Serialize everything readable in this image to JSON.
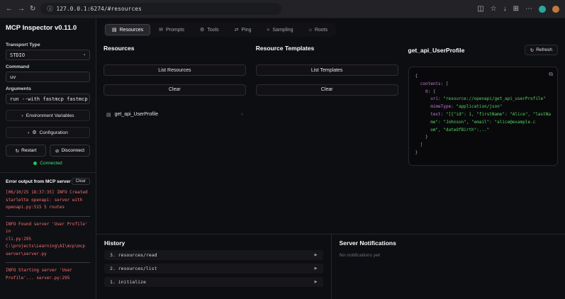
{
  "colors": {
    "accent_green": "#22c55e",
    "error_red": "#f87171",
    "code_string_green": "#56d364",
    "code_key_purple": "#c678dd",
    "panel_background": "#0c0e12"
  },
  "browser": {
    "back_icon": "←",
    "forward_icon": "→",
    "refresh_icon": "↻",
    "site_info_icon": "ⓘ",
    "url": "127.0.0.1:6274/#resources",
    "right_icons": [
      "◫",
      "☆",
      "↓",
      "⊞",
      "⋯"
    ]
  },
  "sidebar": {
    "title": "MCP Inspector v0.11.0",
    "transport": {
      "label": "Transport Type",
      "value": "STDIO"
    },
    "command": {
      "label": "Command",
      "value": "uv"
    },
    "arguments": {
      "label": "Arguments",
      "value": "run --with fastmcp fastmcp run som"
    },
    "env_button": "Environment Variables",
    "config_button": "Configuration",
    "restart_button": "Restart",
    "disconnect_button": "Disconnect",
    "status": "Connected",
    "error_panel": {
      "title": "Error output from MCP server",
      "clear_button": "Clear",
      "log_blocks": [
        [
          "[06/10/25 18:37:35] INFO Created",
          "starlette openapi: server with",
          "openapi.py:515 5 routes"
        ],
        [
          "INFO Found server 'User Profile' in",
          "cli.py:295",
          "C:\\projects\\Learning\\AI\\mcp\\mcp",
          "server\\server.py"
        ],
        [
          "INFO Starting server 'User",
          "Profile'... server.py:295"
        ]
      ]
    }
  },
  "tabs": [
    {
      "icon": "▤",
      "label": "Resources",
      "active": true
    },
    {
      "icon": "✉",
      "label": "Prompts",
      "active": false
    },
    {
      "icon": "⚙",
      "label": "Tools",
      "active": false
    },
    {
      "icon": "⇄",
      "label": "Ping",
      "active": false
    },
    {
      "icon": "≈",
      "label": "Sampling",
      "active": false
    },
    {
      "icon": "⌂",
      "label": "Roots",
      "active": false
    }
  ],
  "resources": {
    "title": "Resources",
    "list_button": "List Resources",
    "clear_button": "Clear",
    "items": [
      {
        "name": "get_api_UserProfile"
      }
    ]
  },
  "templates": {
    "title": "Resource Templates",
    "list_button": "List Templates",
    "clear_button": "Clear"
  },
  "detail": {
    "title": "get_api_UserProfile",
    "refresh_icon": "↻",
    "refresh_button": "Refresh",
    "copy_icon": "⧉",
    "code_lines": [
      [
        {
          "c": "pun",
          "t": "{"
        }
      ],
      [
        {
          "c": "pun",
          "t": "  "
        },
        {
          "c": "key",
          "t": "contents"
        },
        {
          "c": "pun",
          "t": ": ["
        }
      ],
      [
        {
          "c": "pun",
          "t": "    "
        },
        {
          "c": "key",
          "t": "0"
        },
        {
          "c": "pun",
          "t": ": {"
        }
      ],
      [
        {
          "c": "pun",
          "t": "      "
        },
        {
          "c": "key",
          "t": "uri"
        },
        {
          "c": "pun",
          "t": ": "
        },
        {
          "c": "str",
          "t": "\"resource://openapi/get_api_userProfile\""
        }
      ],
      [
        {
          "c": "pun",
          "t": "      "
        },
        {
          "c": "key",
          "t": "mimeType"
        },
        {
          "c": "pun",
          "t": ": "
        },
        {
          "c": "str",
          "t": "\"application/json\""
        }
      ],
      [
        {
          "c": "pun",
          "t": "      "
        },
        {
          "c": "key",
          "t": "text"
        },
        {
          "c": "pun",
          "t": ": "
        },
        {
          "c": "str",
          "t": "\"[{\"id\": 1, \"firstName\": \"Alice\", \"lastNa"
        }
      ],
      [
        {
          "c": "pun",
          "t": "      "
        },
        {
          "c": "str",
          "t": "me\": \"Johnson\", \"email\": \"alice@example.c"
        }
      ],
      [
        {
          "c": "pun",
          "t": "      "
        },
        {
          "c": "str",
          "t": "om\", \"dateOfBirth\":...\""
        }
      ],
      [
        {
          "c": "pun",
          "t": "    }"
        }
      ],
      [
        {
          "c": "pun",
          "t": "  ]"
        }
      ],
      [
        {
          "c": "pun",
          "t": "}"
        }
      ]
    ]
  },
  "history": {
    "title": "History",
    "expand_icon": "▶",
    "items": [
      "3. resources/read",
      "2. resources/list",
      "1. initialize"
    ]
  },
  "notifications": {
    "title": "Server Notifications",
    "empty_text": "No notifications yet"
  }
}
